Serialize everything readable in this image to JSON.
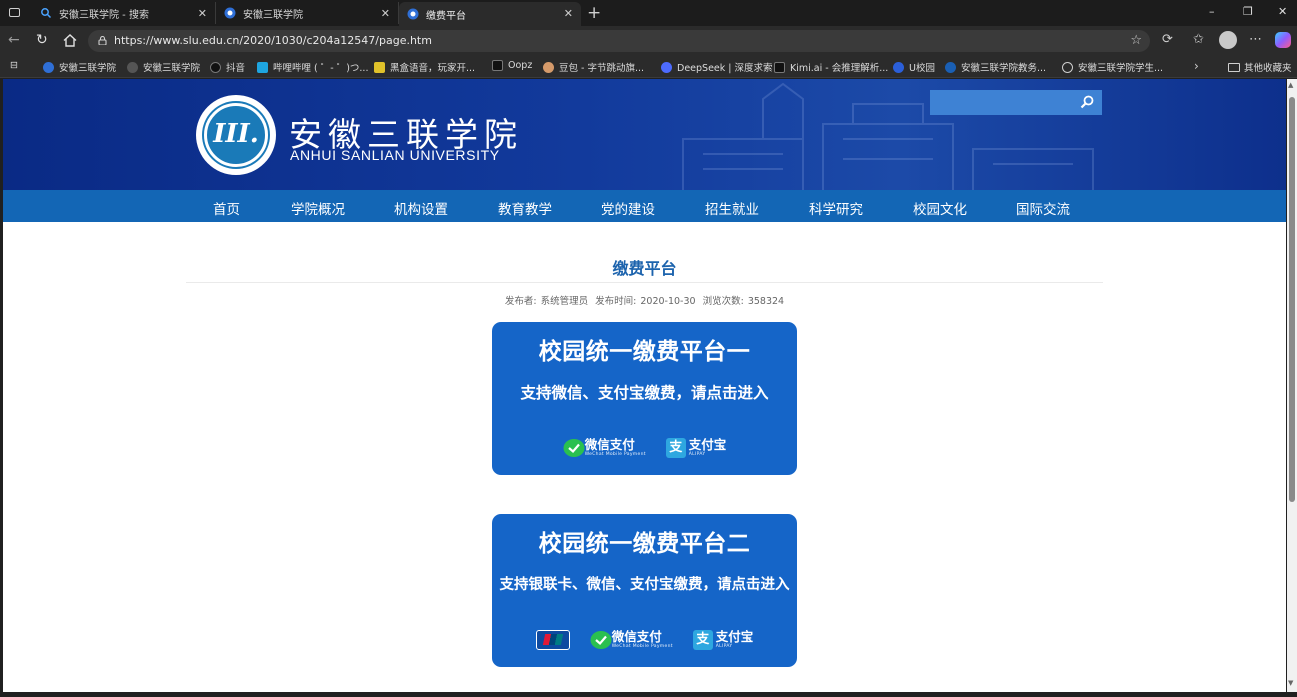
{
  "browser": {
    "tabs": [
      {
        "label": "安徽三联学院 - 搜索",
        "active": false
      },
      {
        "label": "安徽三联学院",
        "active": false
      },
      {
        "label": "缴费平台",
        "active": true
      }
    ],
    "new_tab": "+",
    "window_controls": {
      "minimize": "–",
      "restore": "❐",
      "close": "✕"
    },
    "url": "https://www.slu.edu.cn/2020/1030/c204a12547/page.htm",
    "bookmarks": [
      {
        "label": "安徽三联学院",
        "icon_color": "#2f6fd6"
      },
      {
        "label": "安徽三联学院",
        "icon_color": "#555555"
      },
      {
        "label": "抖音",
        "icon_color": "#111111"
      },
      {
        "label": "哔哩哔哩 ( ゜- ゜)つ...",
        "icon_color": "#1ea5e0"
      },
      {
        "label": "黑盒语音，玩家开...",
        "icon_color": "#e0c22a"
      },
      {
        "label": "Oopz",
        "icon_color": "#111111"
      },
      {
        "label": "豆包 - 字节跳动旗...",
        "icon_color": "#d59a6a"
      },
      {
        "label": "DeepSeek | 深度求索",
        "icon_color": "#4d6bfe"
      },
      {
        "label": "Kimi.ai - 会推理解析...",
        "icon_color": "#111111"
      },
      {
        "label": "U校园",
        "icon_color": "#2b5fd9"
      },
      {
        "label": "安徽三联学院教务...",
        "icon_color": "#1a5fb4"
      },
      {
        "label": "安徽三联学院学生...",
        "icon_color": "#9a9a9a"
      }
    ],
    "other_bookmarks": "其他收藏夹"
  },
  "site": {
    "name_cn": "安徽三联学院",
    "name_en": "ANHUI SANLIAN UNIVERSITY",
    "logo_mark": "III.",
    "search_placeholder": "",
    "nav": [
      "首页",
      "学院概况",
      "机构设置",
      "教育教学",
      "党的建设",
      "招生就业",
      "科学研究",
      "校园文化",
      "国际交流"
    ]
  },
  "article": {
    "title": "缴费平台",
    "meta": {
      "publisher_label": "发布者:",
      "publisher": "系统管理员",
      "time_label": "发布时间:",
      "time": "2020-10-30",
      "views_label": "浏览次数:",
      "views": "358324"
    },
    "cards": [
      {
        "title": "校园统一缴费平台一",
        "subtitle": "支持微信、支付宝缴费，请点击进入",
        "logos": {
          "wechat": "微信支付",
          "wechat_en": "WeChat Mobile Payment",
          "alipay": "支付宝",
          "alipay_en": "ALIPAY"
        }
      },
      {
        "title": "校园统一缴费平台二",
        "subtitle": "支持银联卡、微信、支付宝缴费，请点击进入",
        "logos": {
          "unionpay": true,
          "wechat": "微信支付",
          "wechat_en": "WeChat Mobile Payment",
          "alipay": "支付宝",
          "alipay_en": "ALIPAY"
        }
      }
    ]
  },
  "colors": {
    "header_blue": "#0a2a85",
    "nav_blue": "#1366b5",
    "card_blue": "#1565c8",
    "title_blue": "#1c63ad"
  }
}
